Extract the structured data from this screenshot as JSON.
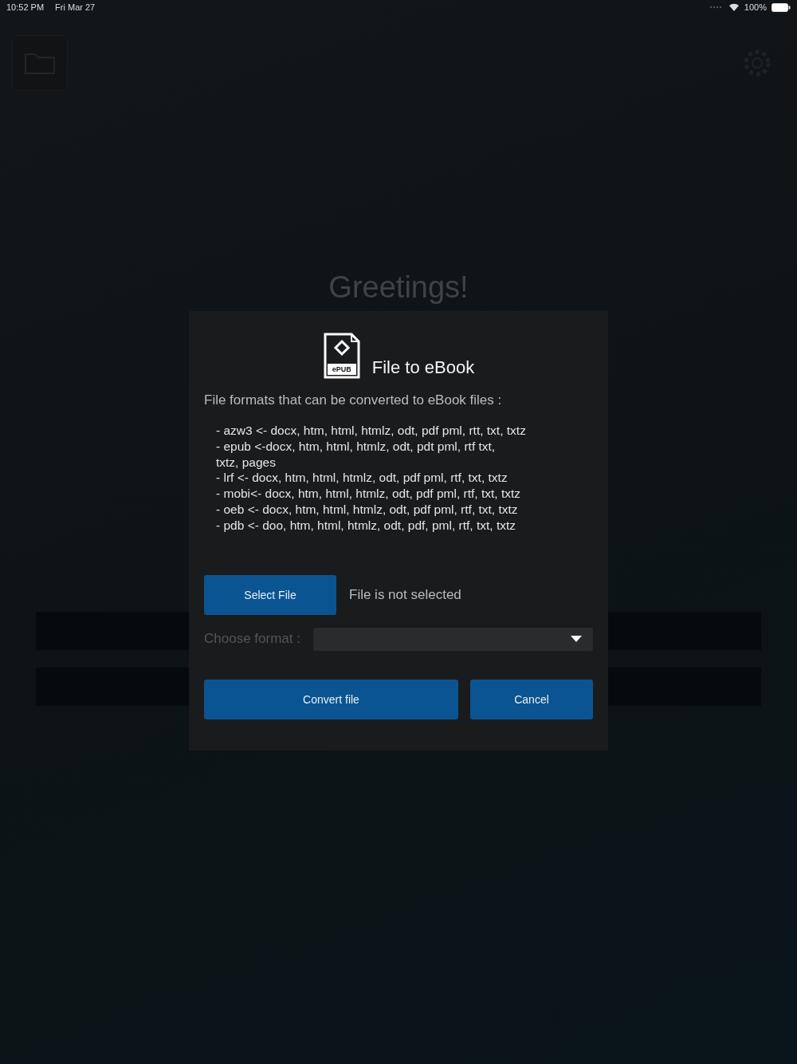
{
  "status_bar": {
    "time": "10:52 PM",
    "date": "Fri Mar 27",
    "battery": "100%"
  },
  "background": {
    "heading": "Greetings!"
  },
  "dialog": {
    "title": "File to eBook",
    "icon_label": "ePUB",
    "intro": "File formats that can be converted to eBook files :",
    "formats": [
      "- azw3 <- docx, htm, html, htmlz, odt, pdf pml, rtt, txt, txtz",
      "- epub <-docx, htm, html, htmlz, odt, pdt pml, rtf txt,",
      "txtz, pages",
      "- lrf <- docx, htm, html, htmlz, odt, pdf pml, rtf, txt, txtz",
      "- mobi<- docx, htm, html, htmlz, odt, pdf pml, rtf, txt, txtz",
      "- oeb <- docx, htm, html, htmlz, odt, pdf pml, rtf, txt, txtz",
      "- pdb <- doo, htm, html, htmlz, odt, pdf, pml, rtf, txt, txtz"
    ],
    "select_button": "Select File",
    "file_status": "File is not selected",
    "format_label": "Choose format :",
    "convert_button": "Convert file",
    "cancel_button": "Cancel"
  }
}
